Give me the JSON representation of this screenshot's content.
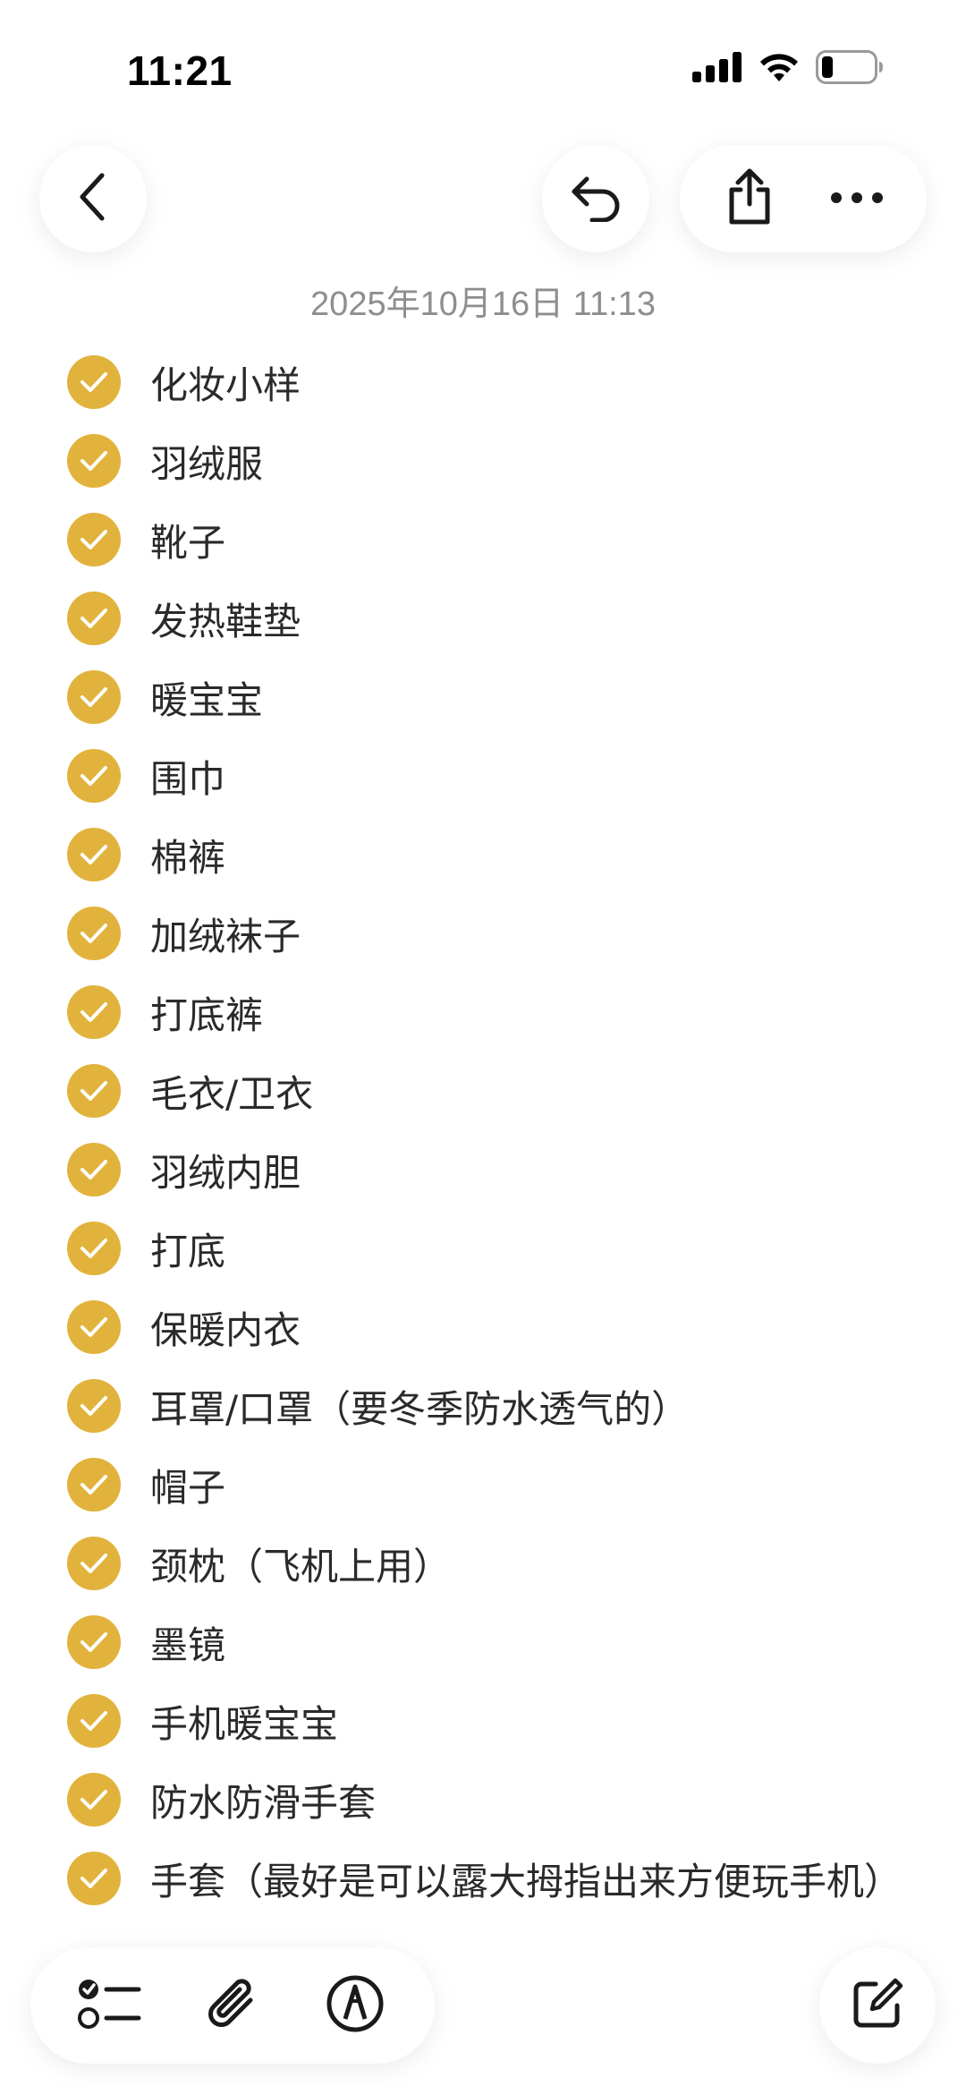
{
  "status_bar": {
    "time": "11:21",
    "icons": [
      "cellular-signal-icon",
      "wifi-icon",
      "battery-icon"
    ]
  },
  "toolbar": {
    "back_icon": "chevron-left-icon",
    "undo_icon": "undo-icon",
    "share_icon": "share-icon",
    "more_icon": "more-icon"
  },
  "note": {
    "date": "2025年10月16日 11:13",
    "accent_color": "#e2b33c",
    "items": [
      {
        "label": "化妆小样",
        "checked": true
      },
      {
        "label": "羽绒服",
        "checked": true
      },
      {
        "label": "靴子",
        "checked": true
      },
      {
        "label": "发热鞋垫",
        "checked": true
      },
      {
        "label": "暖宝宝",
        "checked": true
      },
      {
        "label": "围巾",
        "checked": true
      },
      {
        "label": "棉裤",
        "checked": true
      },
      {
        "label": "加绒袜子",
        "checked": true
      },
      {
        "label": "打底裤",
        "checked": true
      },
      {
        "label": "毛衣/卫衣",
        "checked": true
      },
      {
        "label": "羽绒内胆",
        "checked": true
      },
      {
        "label": "打底",
        "checked": true
      },
      {
        "label": "保暖内衣",
        "checked": true
      },
      {
        "label": "耳罩/口罩（要冬季防水透气的）",
        "checked": true
      },
      {
        "label": "帽子",
        "checked": true
      },
      {
        "label": "颈枕（飞机上用）",
        "checked": true
      },
      {
        "label": "墨镜",
        "checked": true
      },
      {
        "label": "手机暖宝宝",
        "checked": true
      },
      {
        "label": "防水防滑手套",
        "checked": true
      },
      {
        "label": "手套（最好是可以露大拇指出来方便玩手机）",
        "checked": true
      }
    ]
  },
  "bottom_toolbar": {
    "checklist_icon": "checklist-icon",
    "attach_icon": "paperclip-icon",
    "markup_icon": "markup-pen-icon",
    "compose_icon": "compose-icon"
  }
}
